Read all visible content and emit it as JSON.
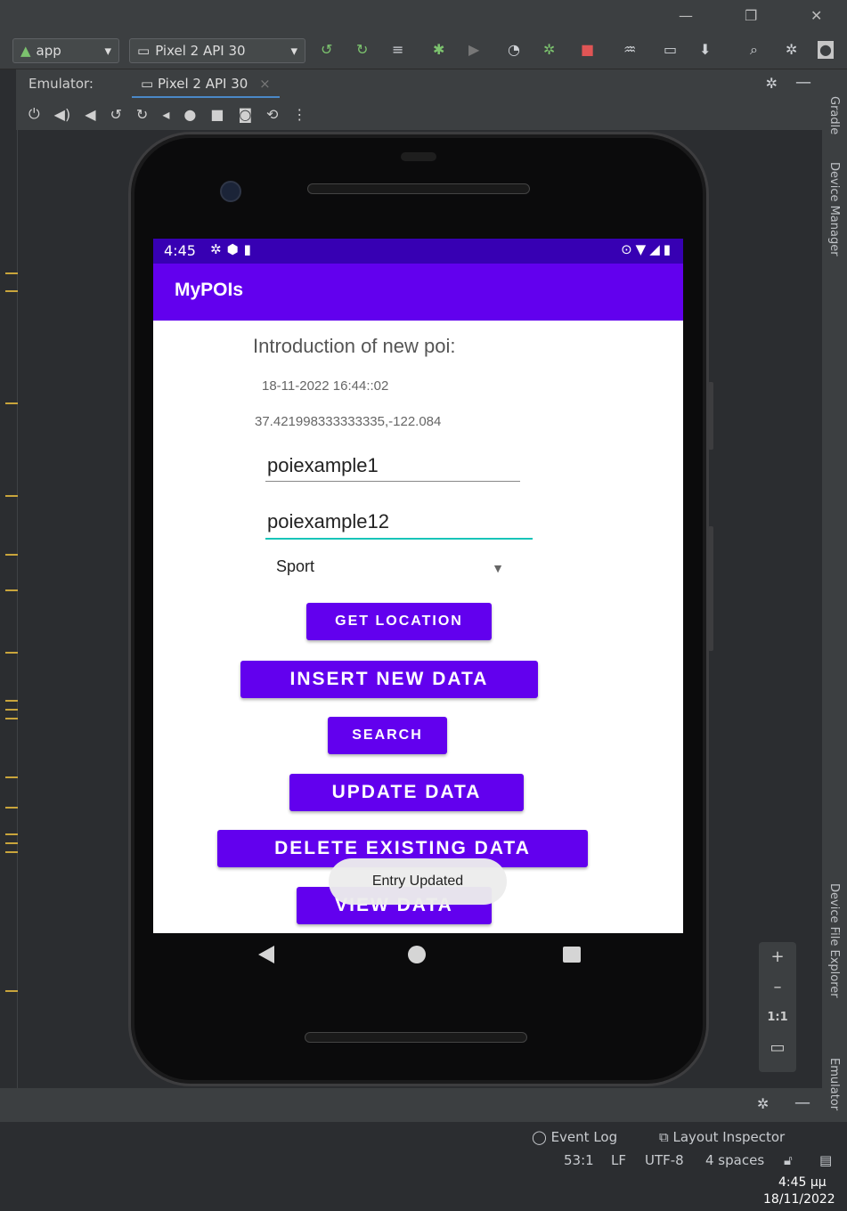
{
  "ide": {
    "run_config": "app",
    "device_selector": "Pixel 2 API 30",
    "emulator_label": "Emulator:",
    "emulator_tab": "Pixel 2 API 30",
    "side_tools": {
      "gradle": "Gradle",
      "device_manager": "Device Manager",
      "device_file_explorer": "Device File Explorer",
      "emulator": "Emulator"
    },
    "zoom": {
      "plus": "+",
      "minus": "–",
      "ratio": "1:1"
    },
    "status": {
      "event_log": "Event Log",
      "layout_inspector": "Layout Inspector",
      "position": "53:1",
      "line_sep": "LF",
      "encoding": "UTF-8",
      "indent": "4 spaces"
    },
    "clock": {
      "time": "4:45 μμ",
      "date": "18/11/2022"
    }
  },
  "phone": {
    "status_time": "4:45",
    "app_title": "MyPOIs",
    "intro": "Introduction of new poi:",
    "datetime": "18-11-2022 16:44::02",
    "coords": "37.421998333333335,-122.084",
    "name_value": "poiexample1",
    "desc_value": "poiexample12",
    "category": "Sport",
    "buttons": {
      "get_location": "Get Location",
      "insert": "Insert New Data",
      "search": "Search",
      "update": "Update Data",
      "delete": "Delete Existing Data",
      "view": "View Data"
    },
    "toast": "Entry Updated"
  },
  "colors": {
    "primary": "#6200ee",
    "primary_dark": "#3700b3",
    "accent": "#18c4b8"
  }
}
